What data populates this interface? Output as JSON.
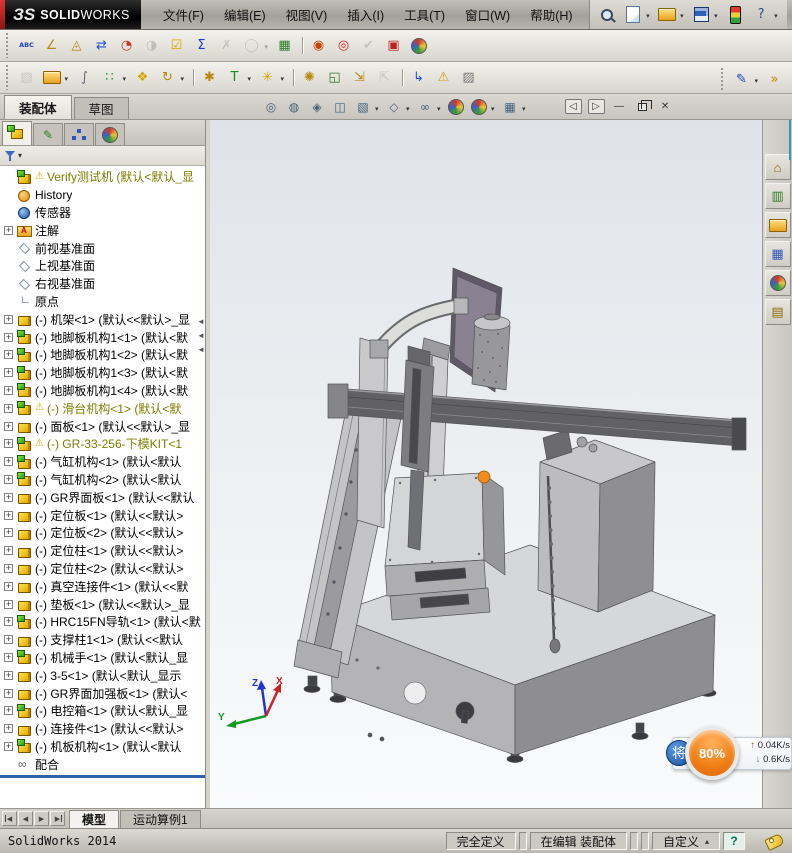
{
  "colors": {
    "accent_red_strip": "#c01818",
    "warning_yellow": "#e0a400",
    "tree_warn_text": "#7d7d00",
    "badge_orange": "#f07d12",
    "speed_up_red": "#d03a2a",
    "speed_down_green": "#2a9a3a",
    "panel_split_blue": "#2f62a8"
  },
  "titlebar": {
    "logo_mark": "ЗS",
    "logo_bold": "SOLID",
    "logo_light": "WORKS",
    "menus": [
      {
        "label": "文件(F)",
        "name": "menu-file"
      },
      {
        "label": "编辑(E)",
        "name": "menu-edit"
      },
      {
        "label": "视图(V)",
        "name": "menu-view"
      },
      {
        "label": "插入(I)",
        "name": "menu-insert"
      },
      {
        "label": "工具(T)",
        "name": "menu-tools"
      },
      {
        "label": "窗口(W)",
        "name": "menu-window"
      },
      {
        "label": "帮助(H)",
        "name": "menu-help"
      }
    ],
    "quick_icons": [
      {
        "name": "search-icon",
        "art": "mag"
      },
      {
        "name": "new-document-icon",
        "art": "page",
        "drop": true
      },
      {
        "name": "open-document-icon",
        "art": "folder",
        "drop": true
      },
      {
        "name": "save-document-icon",
        "art": "floppy",
        "drop": true
      },
      {
        "name": "collaboration-light-icon",
        "art": "traffic"
      },
      {
        "name": "help-icon",
        "glyph": "?",
        "fg": "#2a4a8a",
        "drop": true
      }
    ],
    "window_buttons": [
      {
        "name": "minimize-button",
        "glyph": "–"
      },
      {
        "name": "restore-button",
        "glyph": "",
        "art": "restore"
      },
      {
        "name": "close-button",
        "glyph": "×"
      }
    ]
  },
  "toolbar_tools": {
    "items": [
      {
        "name": "spell-checker-icon",
        "glyph": "ABC",
        "small": true,
        "fg": "#1d3fbb"
      },
      {
        "name": "measure-icon",
        "glyph": "∠",
        "fg": "#b8860b"
      },
      {
        "name": "mass-properties-icon",
        "glyph": "◬",
        "fg": "#b8860b"
      },
      {
        "name": "transfer-icon",
        "glyph": "⇄",
        "fg": "#2255cc"
      },
      {
        "name": "performance-evaluation-icon",
        "glyph": "◔",
        "fg": "#cc3322"
      },
      {
        "name": "statistics-icon",
        "glyph": "◑",
        "fg": "#888",
        "dim": true
      },
      {
        "name": "design-checker-icon",
        "glyph": "☑",
        "fg": "#d4a500"
      },
      {
        "name": "equations-icon",
        "glyph": "Σ",
        "fg": "#1d3fbb"
      },
      {
        "name": "deviation-analysis-icon",
        "glyph": "✗",
        "fg": "#999",
        "dim": true
      },
      {
        "name": "check-icon",
        "glyph": "◯",
        "fg": "#999",
        "dim": true,
        "drop": true
      },
      {
        "name": "design-table-icon",
        "glyph": "▦",
        "fg": "#2a7a2a"
      },
      {
        "sep": true,
        "name": "separator"
      },
      {
        "name": "render-preview-icon",
        "glyph": "◉",
        "fg": "#cc4400"
      },
      {
        "name": "render-options-icon",
        "glyph": "◎",
        "fg": "#cc2222"
      },
      {
        "name": "verification-icon",
        "glyph": "✔",
        "fg": "#999",
        "dim": true
      },
      {
        "name": "compare-docs-icon",
        "glyph": "▣",
        "fg": "#bb2222"
      },
      {
        "name": "color-wheel-icon",
        "art": "sphere"
      }
    ]
  },
  "toolbar_assembly": {
    "items": [
      {
        "name": "insert-component-icon",
        "glyph": "▧",
        "fg": "#999",
        "dim": true
      },
      {
        "name": "insert-from-file-icon",
        "art": "folder",
        "drop": true
      },
      {
        "name": "attach-clip-icon",
        "glyph": "∫",
        "fg": "#667"
      },
      {
        "name": "mate-icon",
        "glyph": "∷",
        "fg": "#2a9a2a",
        "drop": true
      },
      {
        "name": "component-pattern-icon",
        "glyph": "❖",
        "fg": "#d4a500"
      },
      {
        "name": "rotate-component-icon",
        "glyph": "↻",
        "fg": "#b8860b",
        "drop": true
      },
      {
        "sep": true,
        "name": "separator"
      },
      {
        "name": "smart-fasteners-icon",
        "glyph": "✱",
        "fg": "#b8860b"
      },
      {
        "name": "move-with-triad-icon",
        "glyph": "T",
        "fg": "#1f8a1f",
        "drop": true
      },
      {
        "name": "exploded-view-icon",
        "glyph": "✳",
        "fg": "#d4a500",
        "drop": true
      },
      {
        "sep": true,
        "name": "separator"
      },
      {
        "name": "assembly-settings-icon",
        "glyph": "✺",
        "fg": "#b8860b"
      },
      {
        "name": "component-preview-icon",
        "glyph": "◱",
        "fg": "#2a7a2a"
      },
      {
        "name": "move-component-icon",
        "glyph": "⇲",
        "fg": "#b8860b"
      },
      {
        "name": "show-hidden-icon",
        "glyph": "⇱",
        "fg": "#999",
        "dim": true
      },
      {
        "sep": true,
        "name": "separator"
      },
      {
        "name": "leader-arrow-icon",
        "glyph": "↳",
        "fg": "#2255cc"
      },
      {
        "name": "interference-detection-icon",
        "glyph": "⚠",
        "fg": "#caa11a"
      },
      {
        "name": "snapshot-icon",
        "glyph": "▨",
        "fg": "#777"
      }
    ],
    "right_items": [
      {
        "name": "sketch-icon",
        "glyph": "✎",
        "fg": "#1d3fbb",
        "drop": true
      },
      {
        "name": "toolbar-overflow-icon",
        "glyph": "»",
        "fg": "#b8860b"
      }
    ]
  },
  "command_tabs": [
    {
      "label": "装配体",
      "name": "tab-assembly",
      "active": true
    },
    {
      "label": "草图",
      "name": "tab-sketch"
    }
  ],
  "heads_up": {
    "items": [
      {
        "name": "zoom-fit-icon",
        "glyph": "◎"
      },
      {
        "name": "zoom-area-icon",
        "glyph": "◍"
      },
      {
        "name": "zoom-selected-icon",
        "glyph": "◈"
      },
      {
        "name": "section-view-icon",
        "glyph": "◫"
      },
      {
        "name": "view-orientation-icon",
        "glyph": "▧",
        "drop": true
      },
      {
        "name": "display-style-icon",
        "glyph": "◇",
        "drop": true
      },
      {
        "name": "hide-show-items-icon",
        "glyph": "∞",
        "drop": true
      },
      {
        "name": "edit-appearance-icon",
        "art": "sphere"
      },
      {
        "name": "apply-scene-icon",
        "art": "sphere",
        "drop": true
      },
      {
        "name": "view-settings-icon",
        "glyph": "▦",
        "drop": true
      }
    ],
    "mdi_buttons": [
      {
        "name": "pane-collapse-left-button",
        "glyph": "◁",
        "boxed": true
      },
      {
        "name": "pane-collapse-right-button",
        "glyph": "▷",
        "boxed": true
      },
      {
        "name": "doc-minimize-button",
        "glyph": "—"
      },
      {
        "name": "doc-restore-button",
        "glyph": "",
        "art": "restore2"
      },
      {
        "name": "doc-close-button",
        "glyph": "✕"
      }
    ]
  },
  "panel": {
    "tabs": [
      {
        "name": "tab-featuremanager",
        "art": "fm",
        "active": true
      },
      {
        "name": "tab-propertymanager",
        "glyph": "✎",
        "fg": "#2a7a2a"
      },
      {
        "name": "tab-configurationmanager",
        "art": "config"
      },
      {
        "name": "tab-dimxpertmanager",
        "art": "sphere"
      }
    ],
    "overflow": "»"
  },
  "tree": {
    "items": [
      {
        "text": "Verify测试机 (默认<默认_显",
        "icon": "root",
        "warn": true,
        "olive": true,
        "name": "tree-root-verify"
      },
      {
        "text": "History",
        "icon": "history"
      },
      {
        "text": "传感器",
        "icon": "sensor"
      },
      {
        "text": "注解",
        "icon": "ann",
        "expand": true
      },
      {
        "text": "前视基准面",
        "icon": "plane"
      },
      {
        "text": "上视基准面",
        "icon": "plane"
      },
      {
        "text": "右视基准面",
        "icon": "plane"
      },
      {
        "text": "原点",
        "icon": "origin"
      },
      {
        "text": "(-) 机架<1> (默认<<默认>_显",
        "icon": "part",
        "expand": true
      },
      {
        "text": "(-) 地脚板机构1<1> (默认<默",
        "icon": "asm",
        "expand": true
      },
      {
        "text": "(-) 地脚板机构1<2> (默认<默",
        "icon": "asm",
        "expand": true
      },
      {
        "text": "(-) 地脚板机构1<3> (默认<默",
        "icon": "asm",
        "expand": true
      },
      {
        "text": "(-) 地脚板机构1<4> (默认<默",
        "icon": "asm",
        "expand": true
      },
      {
        "text": "(-) 滑台机构<1> (默认<默",
        "icon": "asm",
        "warn": true,
        "olive": true,
        "expand": true
      },
      {
        "text": "(-) 面板<1> (默认<<默认>_显",
        "icon": "part",
        "expand": true
      },
      {
        "text": "(-) GR-33-256-下模KIT<1",
        "icon": "asm",
        "warn": true,
        "olive": true,
        "expand": true
      },
      {
        "text": "(-) 气缸机构<1> (默认<默认",
        "icon": "asm",
        "expand": true
      },
      {
        "text": "(-) 气缸机构<2> (默认<默认",
        "icon": "asm",
        "expand": true
      },
      {
        "text": "(-) GR界面板<1> (默认<<默认",
        "icon": "part",
        "expand": true
      },
      {
        "text": "(-) 定位板<1> (默认<<默认>",
        "icon": "part",
        "expand": true
      },
      {
        "text": "(-) 定位板<2> (默认<<默认>",
        "icon": "part",
        "expand": true
      },
      {
        "text": "(-) 定位柱<1> (默认<<默认>",
        "icon": "part",
        "expand": true
      },
      {
        "text": "(-) 定位柱<2> (默认<<默认>",
        "icon": "part",
        "expand": true
      },
      {
        "text": "(-) 真空连接件<1> (默认<<默",
        "icon": "part",
        "expand": true
      },
      {
        "text": "(-) 垫板<1> (默认<<默认>_显",
        "icon": "part",
        "expand": true
      },
      {
        "text": "(-) HRC15FN导轨<1> (默认<默",
        "icon": "asm",
        "expand": true
      },
      {
        "text": "(-) 支撑柱1<1> (默认<<默认",
        "icon": "part",
        "expand": true
      },
      {
        "text": "(-) 机械手<1> (默认<默认_显",
        "icon": "asm",
        "expand": true
      },
      {
        "text": "(-) 3-5<1> (默认<默认_显示",
        "icon": "part",
        "expand": true
      },
      {
        "text": "(-) GR界面加强板<1> (默认<",
        "icon": "part",
        "expand": true
      },
      {
        "text": "(-) 电控箱<1> (默认<默认_显",
        "icon": "asm",
        "expand": true
      },
      {
        "text": "(-) 连接件<1> (默认<<默认>",
        "icon": "part",
        "expand": true
      },
      {
        "text": "(-) 机板机构<1> (默认<默认",
        "icon": "asm",
        "expand": true
      },
      {
        "text": "配合",
        "icon": "mates"
      }
    ]
  },
  "task_pane": {
    "items": [
      {
        "name": "resources-home-icon",
        "glyph": "⌂",
        "fg": "#8a6a00"
      },
      {
        "name": "design-library-icon",
        "glyph": "▥",
        "fg": "#2a7a2a"
      },
      {
        "name": "file-explorer-icon",
        "art": "folder"
      },
      {
        "name": "view-palette-icon",
        "glyph": "▦",
        "fg": "#3355bb"
      },
      {
        "name": "appearances-icon",
        "art": "sphere"
      },
      {
        "name": "custom-properties-icon",
        "glyph": "▤",
        "fg": "#8a6a00"
      }
    ]
  },
  "viewport": {
    "triad": {
      "x": "X",
      "y": "Y",
      "z": "Z"
    }
  },
  "overlay": {
    "ime_char": "将",
    "percent": "80%",
    "up_speed": "0.04K/s",
    "down_speed": "0.6K/s"
  },
  "bottom": {
    "nav": [
      {
        "name": "tab-scroll-first",
        "glyph": "◀",
        "bar": "left"
      },
      {
        "name": "tab-scroll-prev",
        "glyph": "◀"
      },
      {
        "name": "tab-scroll-next",
        "glyph": "▶"
      },
      {
        "name": "tab-scroll-last",
        "glyph": "▶",
        "bar": "right"
      }
    ],
    "tabs": [
      {
        "label": "模型",
        "name": "tab-model",
        "active": true
      },
      {
        "label": "运动算例1",
        "name": "tab-motion-study-1"
      }
    ]
  },
  "statusbar": {
    "app": "SolidWorks 2014",
    "define_state": "完全定义",
    "editing": "在编辑 装配体",
    "custom": "自定义"
  }
}
